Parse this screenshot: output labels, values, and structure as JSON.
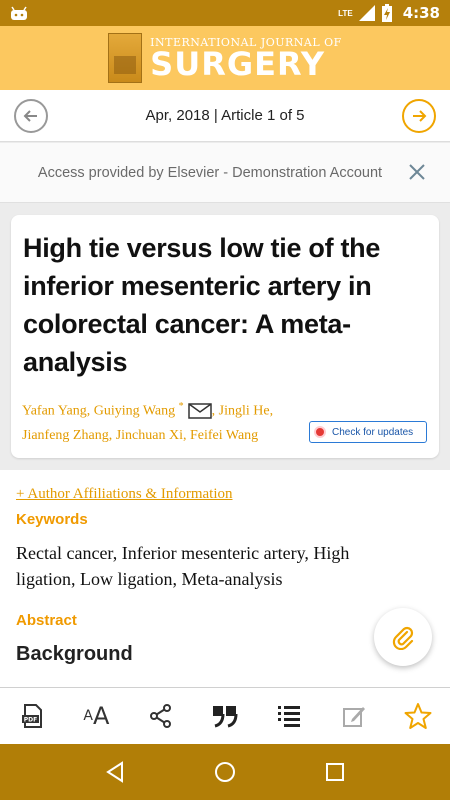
{
  "status_bar": {
    "time": "4:38",
    "network": "LTE"
  },
  "journal": {
    "title_small": "INTERNATIONAL JOURNAL OF",
    "title_large": "SURGERY"
  },
  "article_nav": {
    "text": "Apr, 2018 | Article 1 of 5"
  },
  "access_banner": {
    "text": "Access provided by Elsevier - Demonstration Account"
  },
  "article": {
    "title": "High tie versus low tie of the inferior mesenteric artery in colorectal cancer: A meta-analysis",
    "authors_line1_a": "Yafan Yang, Guiying Wang",
    "author_mark": "*",
    "authors_line1_b": ", Jingli He,",
    "authors_line2": "Jianfeng Zhang, Jinchuan Xi, Feifei Wang",
    "check_updates": "Check for updates"
  },
  "content": {
    "affiliations_link": "+ Author Affiliations & Information",
    "keywords_heading": "Keywords",
    "keywords": "Rectal cancer, Inferior mesenteric artery, High ligation, Low ligation, Meta-analysis",
    "abstract_heading": "Abstract",
    "background_heading": "Background"
  },
  "colors": {
    "accent": "#f0a500",
    "header_bg": "#fcc85f",
    "statusbar_bg": "#b5800c",
    "nav_bg": "#b17e07"
  },
  "toolbar": {
    "icons": [
      "pdf-icon",
      "font-size-icon",
      "share-icon",
      "quote-icon",
      "list-icon",
      "note-icon",
      "star-icon"
    ],
    "pdf_label": "PDF",
    "font_small": "A",
    "font_big": "A"
  }
}
